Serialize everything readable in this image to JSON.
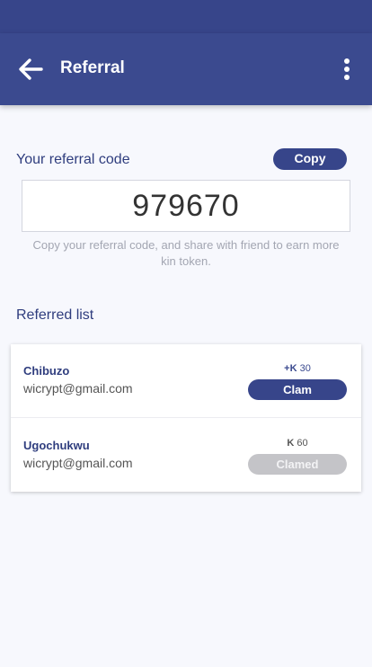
{
  "header": {
    "title": "Referral",
    "back_icon": "arrow-left-icon",
    "menu_icon": "more-vertical-icon"
  },
  "referral": {
    "label": "Your referral code",
    "copy_label": "Copy",
    "code": "979670",
    "hint": "Copy your referral code, and share with friend to earn more kin token."
  },
  "referred": {
    "label": "Referred list",
    "items": [
      {
        "name": "Chibuzo",
        "email": "wicrypt@gmail.com",
        "amount": "+K 30",
        "amount_sign": "+",
        "currency_icon": "kin-icon",
        "amount_value": "30",
        "button": "Clam",
        "state": "active"
      },
      {
        "name": "Ugochukwu",
        "email": "wicrypt@gmail.com",
        "amount": "K 60",
        "amount_sign": "",
        "currency_icon": "kin-icon",
        "amount_value": "60",
        "button": "Clamed",
        "state": "disabled"
      }
    ]
  },
  "colors": {
    "primary": "#3b4a8f",
    "background": "#f7f8fd",
    "disabled": "#c4c4c8"
  }
}
